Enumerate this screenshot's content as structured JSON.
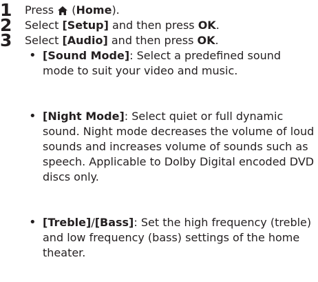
{
  "steps": [
    {
      "num": "1",
      "pre": "Press ",
      "icon": "home-icon",
      "mid": " (",
      "bold": "Home",
      "post": ")."
    },
    {
      "num": "2",
      "pre": "Select ",
      "bold1": "[Setup]",
      "mid": " and then press ",
      "bold2": "OK",
      "post": "."
    },
    {
      "num": "3",
      "pre": "Select ",
      "bold1": "[Audio]",
      "mid": " and then press ",
      "bold2": "OK",
      "post": "."
    }
  ],
  "bullets": [
    {
      "bullet": "•",
      "term": "[Sound Mode]",
      "desc": ": Select a predefined sound mode to suit your video and music."
    },
    {
      "bullet": "•",
      "term": "[Night Mode]",
      "desc": ": Select quiet or full dynamic sound. Night mode decreases the volume of loud sounds and increases volume of sounds such as speech. Applicable to Dolby Digital encoded DVD discs only."
    },
    {
      "term_a": "[Treble]",
      "sep": "/",
      "term_b": "[Bass]",
      "bullet": "•",
      "desc": ": Set the high frequency (treble) and low frequency (bass) settings of the home theater."
    }
  ]
}
